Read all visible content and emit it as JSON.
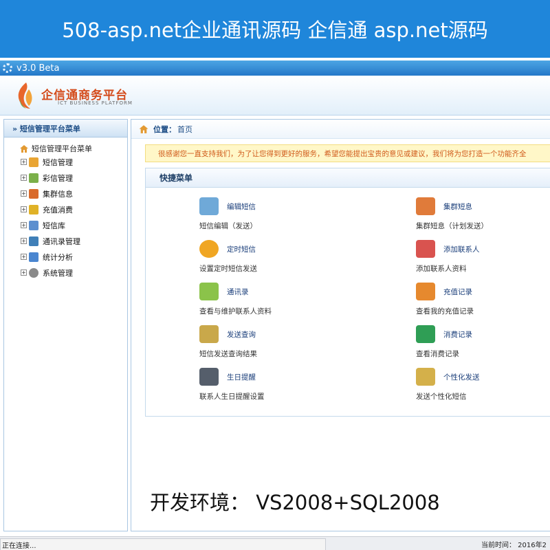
{
  "banner": {
    "text": "508-asp.net企业通讯源码 企信通 asp.net源码"
  },
  "titlebar": {
    "text": "v3.0  Beta",
    "icon": "gear-icon"
  },
  "header": {
    "logo_text": "企信通商务平台",
    "logo_sub": "ICT BUSINESS PLATFORM"
  },
  "sidebar": {
    "title": "» 短信管理平台菜单",
    "root": "短信管理平台菜单",
    "items": [
      {
        "label": "短信管理",
        "icon": "sms-icon",
        "color": "#e9a534"
      },
      {
        "label": "彩信管理",
        "icon": "mms-icon",
        "color": "#7bb04a"
      },
      {
        "label": "集群信息",
        "icon": "group-sms-icon",
        "color": "#d96a2b"
      },
      {
        "label": "充值消费",
        "icon": "recharge-icon",
        "color": "#e0b227"
      },
      {
        "label": "短信库",
        "icon": "sms-library-icon",
        "color": "#5c8fcf"
      },
      {
        "label": "通讯录管理",
        "icon": "contacts-icon",
        "color": "#3f7fb8"
      },
      {
        "label": "统计分析",
        "icon": "chart-icon",
        "color": "#4a86d0"
      },
      {
        "label": "系统管理",
        "icon": "settings-icon",
        "color": "#8a8a8a"
      }
    ]
  },
  "content": {
    "location_label": "位置：",
    "location_value": "首页",
    "notice": "很感谢您一直支持我们，为了让您得到更好的服务，希望您能提出宝贵的意见或建议，我们将为您打造一个功能齐全",
    "quick_title": "快捷菜单",
    "quick_items": [
      {
        "link": "编辑短信",
        "desc": "短信编辑（发送）",
        "icon": "edit-sms-icon",
        "color": "#6fa9d8"
      },
      {
        "link": "集群短息",
        "desc": "集群短息（计划发送）",
        "icon": "group-send-icon",
        "color": "#e07b3a"
      },
      {
        "link": "定时短信",
        "desc": "设置定时短信发送",
        "icon": "alarm-clock-icon",
        "color": "#f0a623"
      },
      {
        "link": "添加联系人",
        "desc": "添加联系人资料",
        "icon": "add-contact-icon",
        "color": "#d9534f"
      },
      {
        "link": "通讯录",
        "desc": "查看与维护联系人资料",
        "icon": "address-book-icon",
        "color": "#8bc34a"
      },
      {
        "link": "充值记录",
        "desc": "查看我的充值记录",
        "icon": "shopping-cart-icon",
        "color": "#e6892e"
      },
      {
        "link": "发送查询",
        "desc": "短信发送查询结果",
        "icon": "send-query-icon",
        "color": "#c9a84a"
      },
      {
        "link": "消费记录",
        "desc": "查看消费记录",
        "icon": "download-icon",
        "color": "#2f9e55"
      },
      {
        "link": "生日提醒",
        "desc": "联系人生日提醒设置",
        "icon": "birthday-icon",
        "color": "#555e6b"
      },
      {
        "link": "个性化发送",
        "desc": "发送个性化短信",
        "icon": "personalized-icon",
        "color": "#d4b04a"
      }
    ]
  },
  "devenv": "开发环境：  VS2008+SQL2008",
  "statusbar": {
    "left": "正在连接...",
    "right": "当前时间： 2016年2"
  }
}
